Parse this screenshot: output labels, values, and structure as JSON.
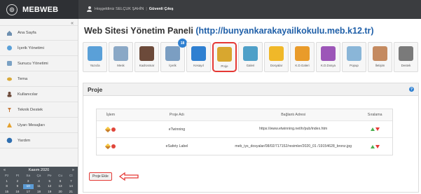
{
  "brand": {
    "name": "MEBWEB"
  },
  "topbar": {
    "welcome": "Hoşgeldiniz SELÇUK ŞAHİN",
    "separator": "|",
    "logout": "Güvenli Çıkış"
  },
  "sidebar": {
    "collapse": "«",
    "items": [
      {
        "label": "Ana Sayfa",
        "icon": "home-icon"
      },
      {
        "label": "İçerik Yönetimi",
        "icon": "content-icon"
      },
      {
        "label": "Sunucu Yönetimi",
        "icon": "server-icon"
      },
      {
        "label": "Tema",
        "icon": "theme-icon"
      },
      {
        "label": "Kullanıcılar",
        "icon": "users-icon"
      },
      {
        "label": "Teknik Destek",
        "icon": "support-icon"
      },
      {
        "label": "Uyarı Mesajları",
        "icon": "alert-icon"
      },
      {
        "label": "Yardım",
        "icon": "help-icon"
      }
    ]
  },
  "calendar": {
    "prev": "«",
    "next": "»",
    "month": "Kasım 2020",
    "days_of_week": [
      "Pz",
      "Pt",
      "Sa",
      "Ça",
      "Pe",
      "Cu",
      "Ct"
    ],
    "rows": [
      [
        "1",
        "2",
        "3",
        "4",
        "5",
        "6",
        "7"
      ],
      [
        "8",
        "9",
        "10",
        "11",
        "12",
        "13",
        "14"
      ],
      [
        "15",
        "16",
        "17",
        "18",
        "19",
        "20",
        "21"
      ]
    ],
    "today": "10"
  },
  "main": {
    "title_prefix": "Web Sitesi Yönetim Paneli",
    "title_url": "(http://bunyankarakayailkokulu.meb.k12.tr)",
    "tools": [
      {
        "label": "Yazıcla",
        "icon": "news-icon",
        "color": "#5aa0d8"
      },
      {
        "label": "Mesk",
        "icon": "list-icon",
        "color": "#8aa8c6"
      },
      {
        "label": "Kadrosmar",
        "icon": "staff-icon",
        "color": "#6c4a3a"
      },
      {
        "label": "İçerik",
        "icon": "content-icon",
        "color": "#7b9ec2",
        "badge": "18"
      },
      {
        "label": "Kesayıl",
        "icon": "star-icon",
        "color": "#2f80d1"
      },
      {
        "label": "Proje",
        "icon": "project-icon",
        "color": "#d8a72f",
        "active": true
      },
      {
        "label": "Galeri",
        "icon": "gallery-icon",
        "color": "#4fa0c8"
      },
      {
        "label": "Dosyalar",
        "icon": "folder-icon",
        "color": "#f0b829"
      },
      {
        "label": "K.D.Galeri",
        "icon": "photo-gallery-icon",
        "color": "#e99b2a"
      },
      {
        "label": "K.D.Dosya",
        "icon": "doc-folder-icon",
        "color": "#9c56b8"
      },
      {
        "label": "Popup",
        "icon": "popup-icon",
        "color": "#8ab6d8"
      },
      {
        "label": "İletişim",
        "icon": "contact-icon",
        "color": "#c48a60"
      },
      {
        "label": "Destek",
        "icon": "support-person-icon",
        "color": "#7a7a7a"
      }
    ],
    "panel": {
      "title": "Proje",
      "help": "?",
      "columns": [
        "İşlem",
        "Proje Adı",
        "Bağlantı Adresi",
        "Sıralama"
      ],
      "rows": [
        {
          "name": "eTwinning",
          "link": "https://www.etwinning.net/tr/pub/index.htm"
        },
        {
          "name": "eSafety Label",
          "link": "meb_iys_dosyalar/08/02/717152/resimler/2020_01 /19154628_bronz.jpg"
        }
      ],
      "add_button": "Proje Ekle"
    }
  }
}
